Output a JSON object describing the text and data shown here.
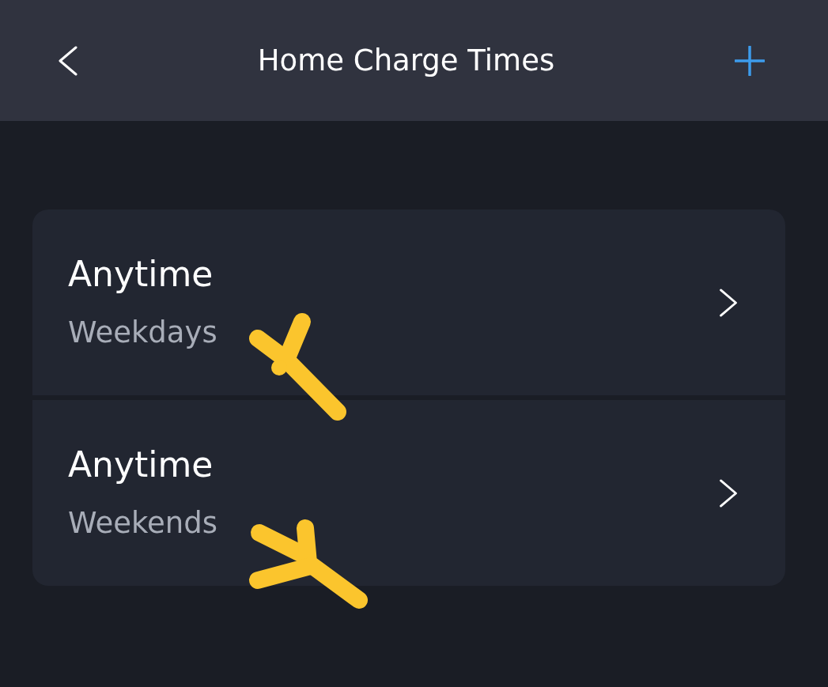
{
  "header": {
    "title": "Home Charge Times"
  },
  "schedules": [
    {
      "title": "Anytime",
      "subtitle": "Weekdays"
    },
    {
      "title": "Anytime",
      "subtitle": "Weekends"
    }
  ]
}
